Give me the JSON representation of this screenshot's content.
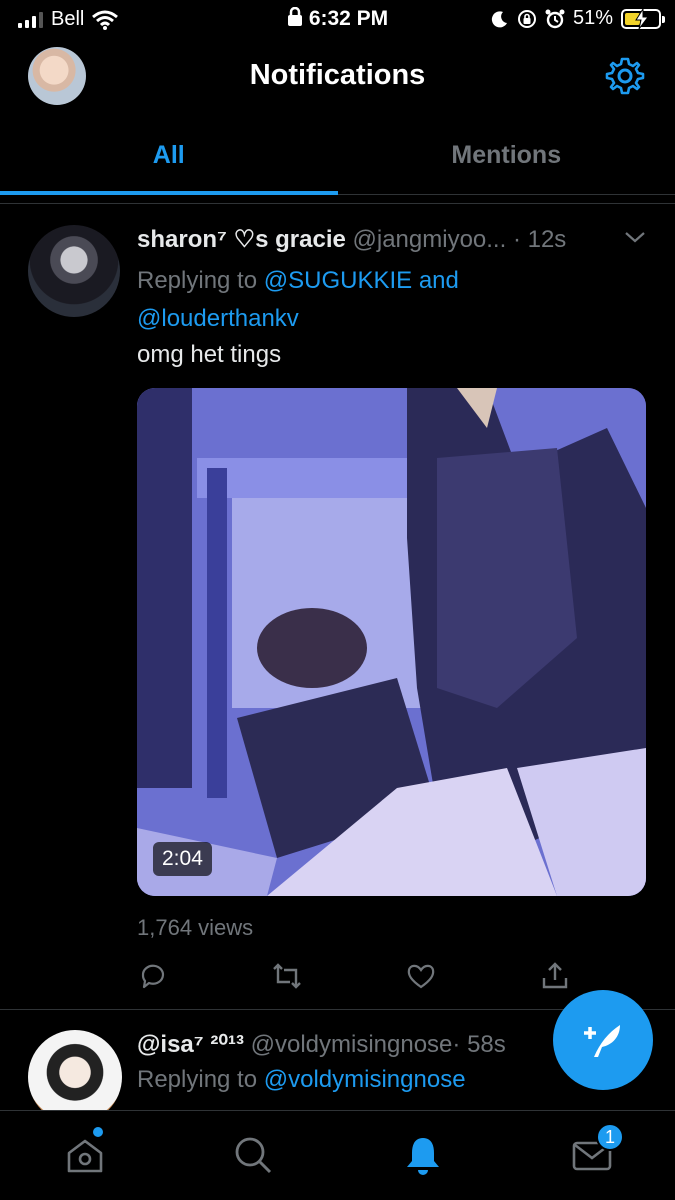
{
  "status_bar": {
    "carrier": "Bell",
    "time": "6:32 PM",
    "battery": "51%"
  },
  "header": {
    "title": "Notifications"
  },
  "tabs": [
    {
      "label": "All",
      "active": true
    },
    {
      "label": "Mentions",
      "active": false
    }
  ],
  "tweets": [
    {
      "name": "sharon⁷ ♡s gracie",
      "handle": "@jangmiyoo...",
      "time": "· 12s",
      "replying_prefix": "Replying to",
      "replying_to_1": "@SUGUKKIE",
      "replying_and": "and",
      "replying_to_2": "@louderthankv",
      "text": "omg het tings",
      "video_duration": "2:04",
      "views": "1,764 views"
    },
    {
      "name": "@isa⁷ ²⁰¹³",
      "handle": "@voldymisingnose",
      "time": "· 58s",
      "replying_prefix": "Replying to",
      "replying_to_1": "@voldymisingnose"
    }
  ],
  "bottom_nav": {
    "messages_badge": "1"
  },
  "colors": {
    "accent": "#1d9bf0",
    "background": "#000000",
    "muted": "#71767b"
  }
}
